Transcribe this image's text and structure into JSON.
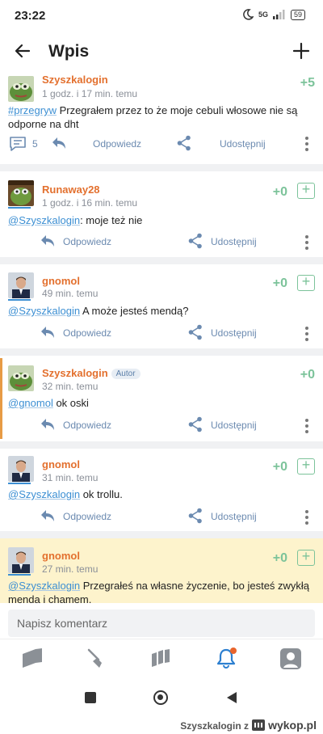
{
  "status": {
    "time": "23:22",
    "network": "5G",
    "battery": "59"
  },
  "appbar": {
    "title": "Wpis",
    "back_icon": "arrow-left-icon",
    "add_icon": "plus-icon"
  },
  "main_post": {
    "author": "Szyszkalogin",
    "time": "1 godz. i 17 min. temu",
    "votes": "+5",
    "hashtag": "#przegryw",
    "text": " Przegrałem przez to że moje cebuli włosowe nie są odporne na dht",
    "comment_count": "5",
    "reply_label": "Odpowiedz",
    "share_label": "Udostępnij"
  },
  "comments": [
    {
      "author": "Runaway28",
      "time": "1 godz. i 16 min. temu",
      "votes": "+0",
      "mention": "@Szyszkalogin",
      "text": ": moje też nie",
      "reply_label": "Odpowiedz",
      "share_label": "Udostępnij"
    },
    {
      "author": "gnomol",
      "time": "49 min. temu",
      "votes": "+0",
      "mention": "@Szyszkalogin",
      "text": " A może jesteś mendą?",
      "reply_label": "Odpowiedz",
      "share_label": "Udostępnij"
    },
    {
      "author": "Szyszkalogin",
      "badge": "Autor",
      "time": "32 min. temu",
      "votes": "+0",
      "mention": "@gnomol",
      "text": " ok oski",
      "reply_label": "Odpowiedz",
      "share_label": "Udostępnij"
    },
    {
      "author": "gnomol",
      "time": "31 min. temu",
      "votes": "+0",
      "mention": "@Szyszkalogin",
      "text": " ok trollu.",
      "reply_label": "Odpowiedz",
      "share_label": "Udostępnij"
    },
    {
      "author": "gnomol",
      "time": "27 min. temu",
      "votes": "+0",
      "mention": "@Szyszkalogin",
      "text": " Przegrałeś na własne życzenie, bo jesteś zwykłą mendą i chamem."
    }
  ],
  "composer": {
    "placeholder": "Napisz komentarz"
  },
  "bottom_nav": [
    "home-icon",
    "shovel-icon",
    "microblog-icon",
    "bell-icon",
    "profile-icon"
  ],
  "footer": {
    "source": "Szyszkalogin z",
    "logo": "wykop.pl"
  },
  "colors": {
    "author": "#e3702e",
    "vote": "#7cc39a",
    "link": "#3c8fd3",
    "action": "#6b8ab0",
    "highlight": "#fdf3cc",
    "accent": "#e79b45"
  }
}
